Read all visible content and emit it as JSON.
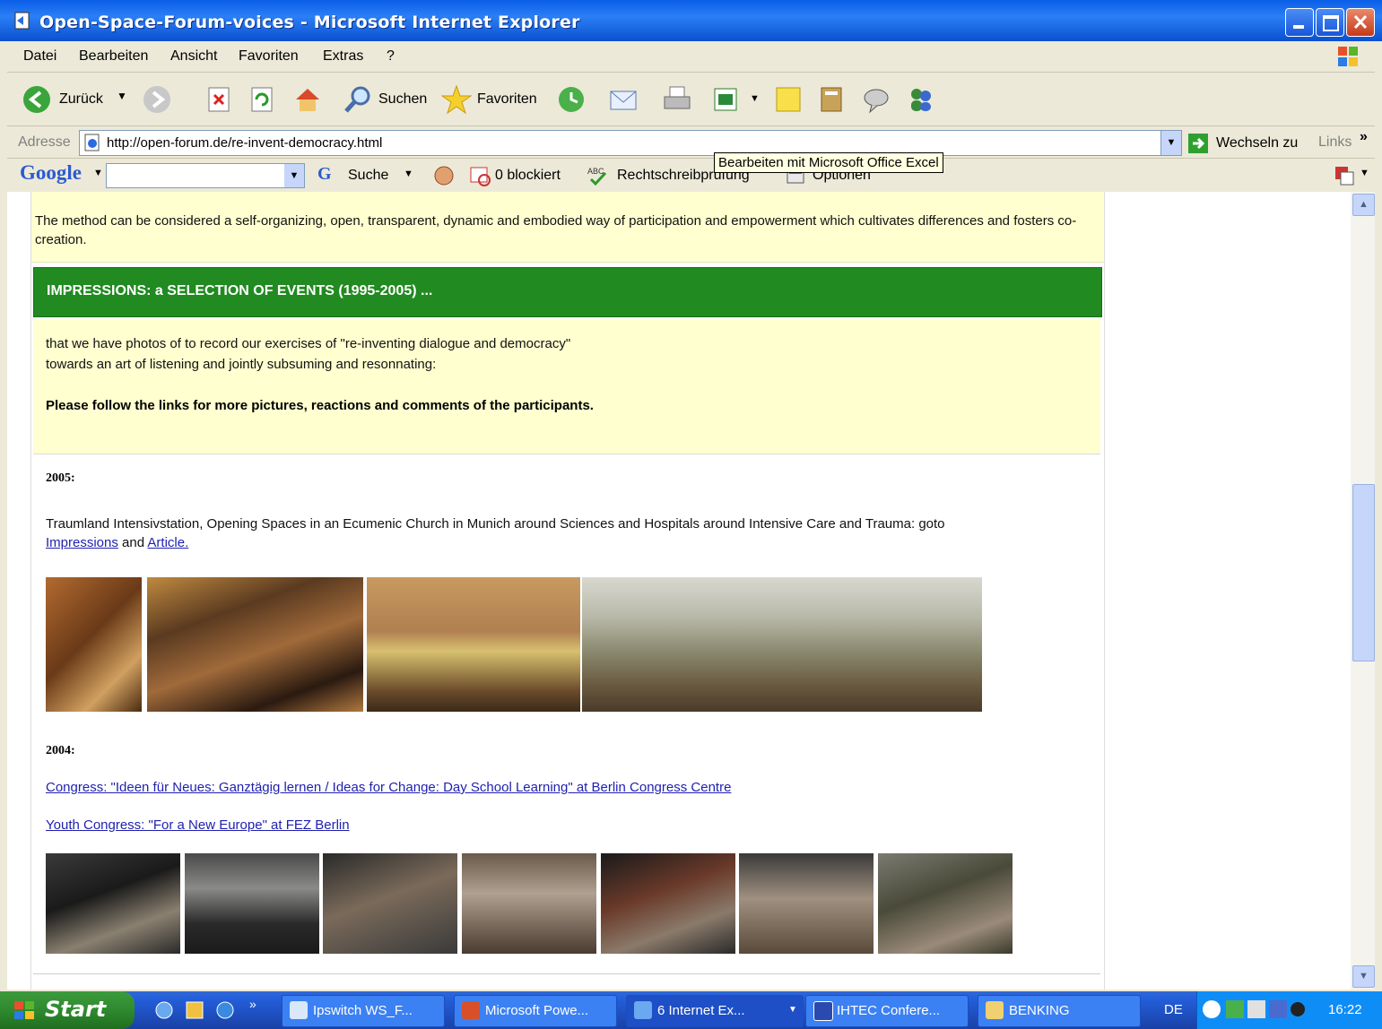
{
  "window": {
    "title": "Open-Space-Forum-voices - Microsoft Internet Explorer"
  },
  "menu": [
    "Datei",
    "Bearbeiten",
    "Ansicht",
    "Favoriten",
    "Extras",
    "?"
  ],
  "toolbar": {
    "back_label": "Zurück",
    "search_label": "Suchen",
    "favorites_label": "Favoriten"
  },
  "address": {
    "label": "Adresse",
    "url": "http://open-forum.de/re-invent-democracy.html",
    "go_label": "Wechseln zu",
    "links_label": "Links"
  },
  "google_bar": {
    "search_label": "Suche",
    "blocked_label": "0 blockiert",
    "spellcheck_label": "Rechtschreibprüfung",
    "options_label": "Optionen"
  },
  "tooltip": "Bearbeiten mit Microsoft Office Excel",
  "page": {
    "intro_text": "The method can be considered a self-organizing, open, transparent, dynamic and embodied way of participation and empowerment which cultivates differences and fosters co-creation.",
    "section_header": "IMPRESSIONS: a SELECTION OF EVENTS (1995-2005) ...",
    "desc_line1": "that we have photos of to record our exercises of \"re-inventing dialogue and democracy\"",
    "desc_line2": "towards an art of listening and jointly subsuming and resonnating:",
    "follow_text": "Please follow the links for more pictures, reactions and comments of the participants.",
    "year_2005": "2005:",
    "event_2005_text": "Traumland Intensivstation, Opening Spaces in an Ecumenic Church in Munich around Sciences and Hospitals around Intensive Care and Trauma: goto",
    "link_impressions": "Impressions",
    "and_text": "and",
    "link_article": "Article.",
    "year_2004": "2004:",
    "link_congress": "Congress: \"Ideen für Neues: Ganztägig lernen / Ideas for Change: Day School Learning\" at Berlin Congress Centre",
    "link_youth": "Youth Congress: \"For a New Europe\" at FEZ Berlin"
  },
  "taskbar": {
    "start_label": "Start",
    "tasks": [
      {
        "label": "Ipswitch WS_F..."
      },
      {
        "label": "Microsoft Powe..."
      },
      {
        "label": "6 Internet Ex..."
      },
      {
        "label": "IHTEC Confere..."
      },
      {
        "label": "BENKING"
      }
    ],
    "lang": "DE",
    "time": "16:22"
  },
  "colors": {
    "section_green": "#218a21",
    "cream_bg": "#ffffd0",
    "link_blue": "#1f1fb0"
  }
}
